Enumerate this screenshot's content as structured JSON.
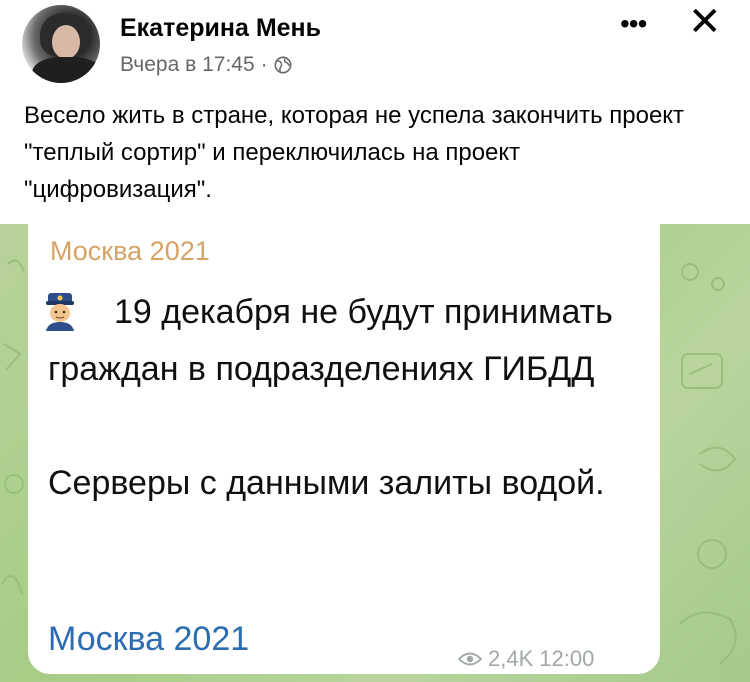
{
  "post": {
    "author": "Екатерина Мень",
    "time": "Вчера в 17:45",
    "separator": "·",
    "text": "Весело жить в стране, которая не успела закончить проект \"теплый сортир\" и переключилась на проект \"цифровизация\"."
  },
  "header_icons": {
    "more": "•••",
    "close": "✕",
    "audience": "globe-icon"
  },
  "telegram": {
    "channel": "Москва 2021",
    "message_line1": "19 декабря не будут принимать граждан в подразделениях ГИБДД",
    "message_line2": "Серверы с данными залиты водой.",
    "footer_link": "Москва 2021",
    "views": "2,4K",
    "time": "12:00"
  },
  "colors": {
    "channel_name": "#d6a265",
    "link": "#2c6cb0",
    "chat_background": "#b0d190"
  }
}
